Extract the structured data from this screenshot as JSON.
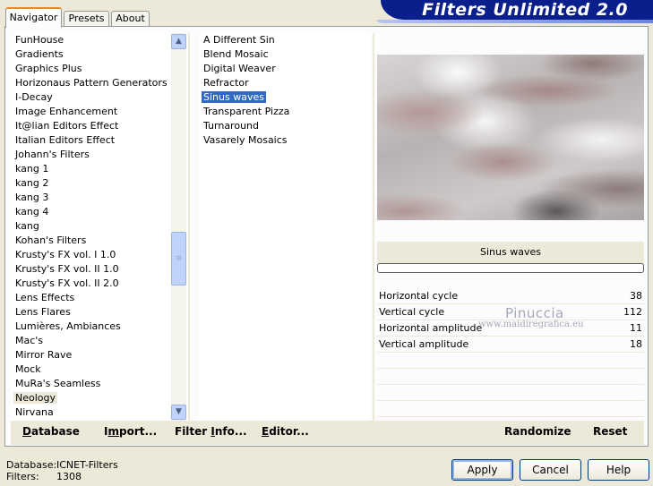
{
  "banner": {
    "title": "Filters Unlimited 2.0"
  },
  "tabs": [
    {
      "label": "Navigator",
      "active": true
    },
    {
      "label": "Presets",
      "active": false
    },
    {
      "label": "About",
      "active": false
    }
  ],
  "categories": [
    "FunHouse",
    "Gradients",
    "Graphics Plus",
    "Horizonaus Pattern Generators",
    "I-Decay",
    "Image Enhancement",
    "It@lian Editors Effect",
    "Italian Editors Effect",
    "Johann's Filters",
    "kang 1",
    "kang 2",
    "kang 3",
    "kang 4",
    "kang",
    "Kohan's Filters",
    "Krusty's FX vol. I 1.0",
    "Krusty's FX vol. II 1.0",
    "Krusty's FX vol. II 2.0",
    "Lens Effects",
    "Lens Flares",
    "Lumières, Ambiances",
    "Mac's",
    "Mirror Rave",
    "Mock",
    "MuRa's Seamless",
    "Neology",
    "Nirvana"
  ],
  "selected_category": "Neology",
  "filters": [
    "A Different Sin",
    "Blend Mosaic",
    "Digital Weaver",
    "Refractor",
    "Sinus waves",
    "Transparent Pizza",
    "Turnaround",
    "Vasarely Mosaics"
  ],
  "selected_filter": "Sinus waves",
  "filter_panel": {
    "name": "Sinus waves",
    "progress": 0
  },
  "parameters": [
    {
      "label": "Horizontal cycle",
      "value": "38"
    },
    {
      "label": "Vertical cycle",
      "value": "112"
    },
    {
      "label": "Horizontal amplitude",
      "value": "11"
    },
    {
      "label": "Vertical amplitude",
      "value": "18"
    }
  ],
  "watermark": {
    "line1": "Pinuccia",
    "line2": "www.maidiregrafica.eu"
  },
  "bottom_buttons": {
    "database": {
      "first": "D",
      "rest": "atabase"
    },
    "import": {
      "pre": "I",
      "mid": "m",
      "post": "port..."
    },
    "filter_info": {
      "pre": "Filter ",
      "mid": "I",
      "post": "nfo..."
    },
    "editor": {
      "first": "E",
      "rest": "ditor..."
    },
    "randomize": "Randomize",
    "reset": "Reset"
  },
  "status": {
    "database_label": "Database:",
    "database_value": "ICNET-Filters",
    "filters_label": "Filters:",
    "filters_value": "1308"
  },
  "dialog_buttons": {
    "apply": "Apply",
    "cancel": "Cancel",
    "help": "Help"
  },
  "icons": {
    "scroll_up": "chevron-up-icon",
    "scroll_down": "chevron-down-icon",
    "scroll_grip": "grip-icon"
  },
  "colors": {
    "banner": "#0a1e8c",
    "selection": "#316ac5",
    "tab_accent": "#e68b2c",
    "dialog_bg": "#ece9d8"
  }
}
